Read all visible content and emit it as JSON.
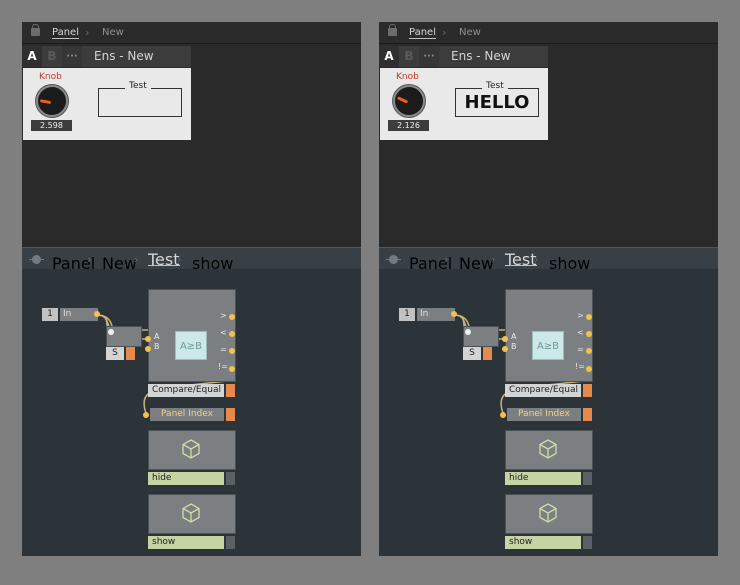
{
  "left": {
    "breadcrumb": [
      "Panel",
      "New"
    ],
    "tabs": {
      "a": "A",
      "b": "B",
      "dots": "···",
      "title": "Ens - New"
    },
    "knob": {
      "label": "Knob",
      "value": "2.598"
    },
    "test": {
      "label": "Test",
      "value": ""
    },
    "lower_breadcrumb": [
      "Panel",
      "New",
      "Test",
      "show"
    ],
    "modules": {
      "in_num": "1",
      "in_label": "In",
      "s_label": "S",
      "port_a": "A",
      "port_b": "B",
      "compare_glyph": "A≥B",
      "compare_label": "Compare/Equal",
      "outs": [
        ">",
        "<",
        "=",
        "!="
      ],
      "panel_index": "Panel Index",
      "hide": "hide",
      "show": "show"
    }
  },
  "right": {
    "breadcrumb": [
      "Panel",
      "New"
    ],
    "tabs": {
      "a": "A",
      "b": "B",
      "dots": "···",
      "title": "Ens - New"
    },
    "knob": {
      "label": "Knob",
      "value": "2.126"
    },
    "test": {
      "label": "Test",
      "value": "HELLO"
    },
    "lower_breadcrumb": [
      "Panel",
      "New",
      "Test",
      "show"
    ],
    "modules": {
      "in_num": "1",
      "in_label": "In",
      "s_label": "S",
      "port_a": "A",
      "port_b": "B",
      "compare_glyph": "A≥B",
      "compare_label": "Compare/Equal",
      "outs": [
        ">",
        "<",
        "=",
        "!="
      ],
      "panel_index": "Panel Index",
      "hide": "hide",
      "show": "show"
    }
  },
  "colors": {
    "accent_orange": "#e58a4c",
    "port_yellow": "#f2c14e",
    "knob_label_red": "#c0392b"
  }
}
